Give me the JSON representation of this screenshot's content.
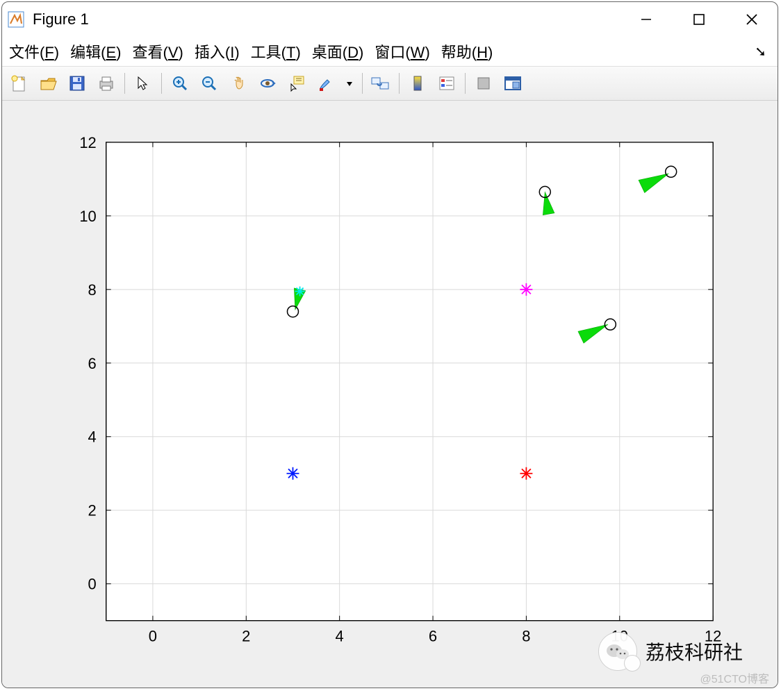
{
  "window": {
    "title": "Figure 1"
  },
  "menu": {
    "items": [
      {
        "label": "文件",
        "mn": "F"
      },
      {
        "label": "编辑",
        "mn": "E"
      },
      {
        "label": "查看",
        "mn": "V"
      },
      {
        "label": "插入",
        "mn": "I"
      },
      {
        "label": "工具",
        "mn": "T"
      },
      {
        "label": "桌面",
        "mn": "D"
      },
      {
        "label": "窗口",
        "mn": "W"
      },
      {
        "label": "帮助",
        "mn": "H"
      }
    ]
  },
  "toolbar": {
    "buttons": [
      "new-figure",
      "open",
      "save",
      "print",
      "sep",
      "pointer",
      "sep",
      "zoom-in",
      "zoom-out",
      "pan",
      "rotate-3d",
      "data-cursor",
      "brush",
      "dropdown",
      "sep",
      "link-axes",
      "sep",
      "colorbar",
      "legend",
      "sep",
      "hide-plot",
      "dock"
    ]
  },
  "chart_data": {
    "type": "scatter",
    "xlim": [
      -1,
      12
    ],
    "ylim": [
      -1,
      12
    ],
    "xticks": [
      0,
      2,
      4,
      6,
      8,
      10,
      12
    ],
    "yticks": [
      0,
      2,
      4,
      6,
      8,
      10,
      12
    ],
    "title": "",
    "xlabel": "",
    "ylabel": "",
    "series": [
      {
        "name": "targets",
        "marker": "open-circle",
        "color": "#000000",
        "points": [
          {
            "x": 3.0,
            "y": 7.4
          },
          {
            "x": 8.4,
            "y": 10.65
          },
          {
            "x": 9.8,
            "y": 7.05
          },
          {
            "x": 11.1,
            "y": 11.2
          }
        ]
      },
      {
        "name": "heading-wedges",
        "marker": "wedge",
        "color": "#0bdb0b",
        "points": [
          {
            "tip_x": 3.05,
            "tip_y": 7.45,
            "base_x": 3.15,
            "base_y": 8.0,
            "width": 0.25
          },
          {
            "tip_x": 8.4,
            "tip_y": 10.65,
            "base_x": 8.48,
            "base_y": 10.05,
            "width": 0.25
          },
          {
            "tip_x": 9.75,
            "tip_y": 7.05,
            "base_x": 9.17,
            "base_y": 6.7,
            "width": 0.28
          },
          {
            "tip_x": 11.05,
            "tip_y": 11.15,
            "base_x": 10.47,
            "base_y": 10.8,
            "width": 0.3
          }
        ]
      },
      {
        "name": "ref-blue",
        "marker": "asterisk",
        "color": "#0019ff",
        "points": [
          {
            "x": 3.0,
            "y": 3.0
          }
        ]
      },
      {
        "name": "ref-red",
        "marker": "asterisk",
        "color": "#ff0000",
        "points": [
          {
            "x": 8.0,
            "y": 3.0
          }
        ]
      },
      {
        "name": "ref-magenta",
        "marker": "asterisk",
        "color": "#ff00ff",
        "points": [
          {
            "x": 8.0,
            "y": 8.0
          }
        ]
      },
      {
        "name": "ref-cyan",
        "marker": "asterisk",
        "color": "#00eaea",
        "points": [
          {
            "x": 3.15,
            "y": 7.95
          }
        ]
      }
    ]
  },
  "watermarks": {
    "cn": "荔枝科研社",
    "cto": "@51CTO博客"
  }
}
